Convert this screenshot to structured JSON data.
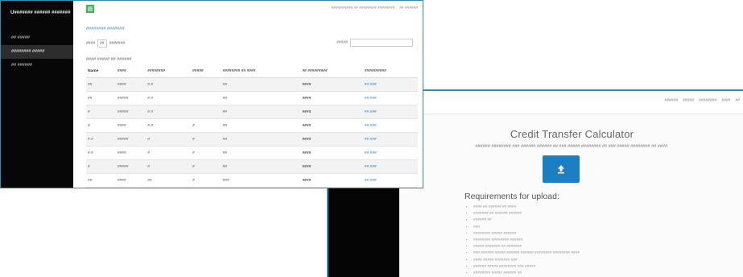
{
  "front": {
    "brand": "U####### ###### #######",
    "menu": [
      {
        "label": "## #####",
        "active": false
      },
      {
        "label": "######## #####",
        "active": true
      },
      {
        "label": "## ######",
        "active": false
      }
    ],
    "top_right": [
      "########## ## ######## ########",
      "## ######"
    ],
    "breadcrumb": "######## #######",
    "show_prefix": "####",
    "show_value": "##",
    "show_suffix": "#######",
    "search_label": "#####",
    "search_value": "",
    "caption": "#### ##### ## ######",
    "columns": [
      "Name",
      "####",
      "########",
      "#####",
      "######## ## ####",
      "## #########",
      "##########"
    ],
    "rows": [
      [
        "##",
        "####",
        "#.#",
        "",
        "##",
        "####",
        "##.###"
      ],
      [
        "##",
        "#####",
        "#.#",
        "",
        "##",
        "####",
        "##.###"
      ],
      [
        "#",
        "#####",
        "#.#",
        "",
        "##",
        "####",
        "##.###"
      ],
      [
        "#",
        "####",
        "#.#",
        "#",
        "##",
        "####",
        "##.###"
      ],
      [
        "#.#",
        "#####",
        "#",
        "#",
        "##",
        "####",
        "##.###"
      ],
      [
        "#.#",
        "####",
        "#",
        "#",
        "##",
        "####",
        "##.###"
      ],
      [
        "#",
        "#####",
        "#",
        "#",
        "##",
        "####",
        "##.###"
      ],
      [
        "##",
        "####",
        "##",
        "#",
        "###",
        "####",
        "##.###"
      ],
      [
        "##.#",
        "#####",
        "##",
        "#",
        "##",
        "####",
        "##.###"
      ],
      [
        "##.#",
        "####",
        "##",
        "#",
        "##",
        "####",
        "##.###"
      ]
    ]
  },
  "back": {
    "nav": [
      "######",
      "#####",
      "########",
      "####",
      "##"
    ],
    "title": "Credit Transfer Calculator",
    "subtitle": "###### ######## ### ###### ###### ## ### ##### ######## ## ### ##### ######## ## ####.",
    "requirements_title": "Requirements for upload:",
    "requirements": [
      "#### ## ###### ## ####",
      "####### ## ###### ######",
      "###### ##",
      "###",
      "######## ##### ######",
      "######## ######## ######",
      "##### ####### ## #######",
      "### ###### ##### ###### ###### ######## ######## ####",
      "#### ##### ####### ###",
      "###### ##### ######## ### #####",
      "######## ##### ###### ##"
    ]
  }
}
